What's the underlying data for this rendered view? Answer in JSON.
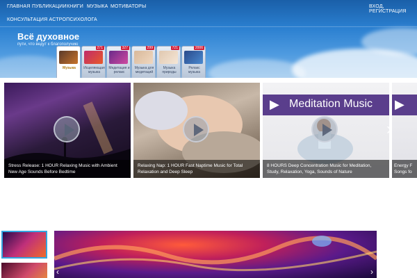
{
  "nav": {
    "items": [
      {
        "label": "ГЛАВНАЯ"
      },
      {
        "label": "ПУБЛИКАЦИИ"
      },
      {
        "label": "КНИГИ"
      },
      {
        "label": "МУЗЫКА"
      },
      {
        "label": "МОТИВАТОРЫ"
      },
      {
        "label": "КОНСУЛЬТАЦИЯ АСТРОПСИХОЛОГА"
      }
    ],
    "login": "ВХОД, РЕГИСТРАЦИЯ"
  },
  "site": {
    "title": "Всё духовное",
    "subtitle": "пути, что ведут к благополучию"
  },
  "tabs": [
    {
      "label": "Музыка",
      "count": "",
      "active": true
    },
    {
      "label": "Исцеляющая музыка",
      "count": "271"
    },
    {
      "label": "Медитация и релакс",
      "count": "327"
    },
    {
      "label": "Музыка для медитаций",
      "count": "299"
    },
    {
      "label": "Музыка природы",
      "count": "721"
    },
    {
      "label": "Релакс музыка",
      "count": "2006"
    }
  ],
  "videos": [
    {
      "title": "Stress Release: 1 HOUR Relaxing Music with Ambient New Age Sounds Before Bedtime"
    },
    {
      "title": "Relaxing Nap: 1 HOUR Fast Naptime Music for Total Relaxation and Deep Sleep"
    },
    {
      "title": "8 HOURS Deep Concentration Music for Meditation, Study, Relaxation, Yoga, Sounds of Nature",
      "banner": "Meditation Music"
    },
    {
      "title": "Energy F Songs fo"
    }
  ],
  "icons": {
    "play": "play-icon",
    "next": "chevron-right-icon",
    "prev": "chevron-left-icon"
  },
  "colors": {
    "accent": "#33a6e0",
    "badge": "#d0203a",
    "banner": "#5a3e8c"
  }
}
